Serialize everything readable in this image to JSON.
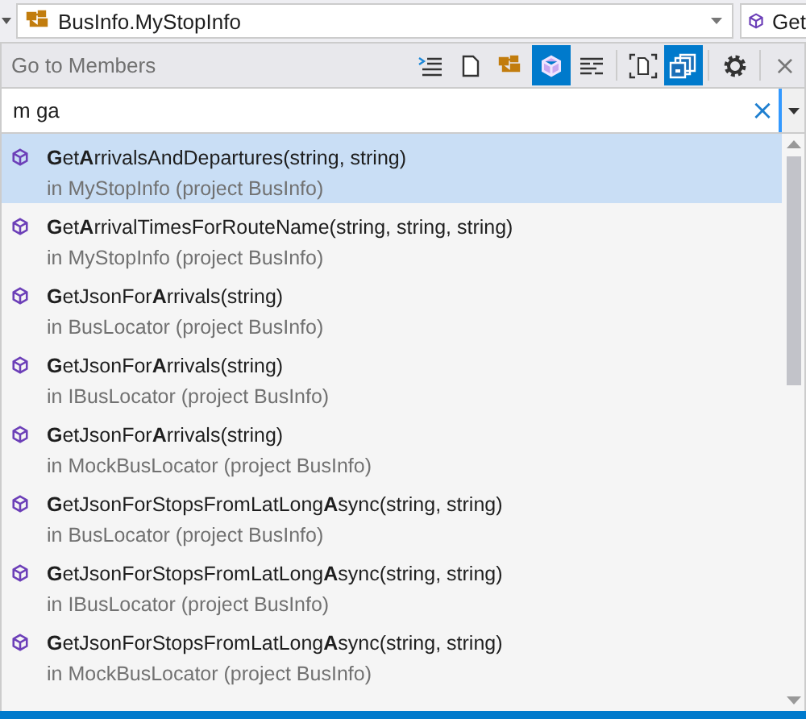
{
  "navigation_bar": {
    "type_dropdown": {
      "value": "BusInfo.MyStopInfo"
    },
    "member_dropdown": {
      "value": "Get"
    }
  },
  "panel": {
    "title": "Go to Members",
    "toolbar": [
      {
        "selected": false
      },
      {
        "selected": false
      },
      {
        "selected": false
      },
      {
        "selected": true
      },
      {
        "selected": false
      },
      {
        "selected": false
      },
      {
        "selected": true
      },
      {
        "selected": false
      }
    ],
    "close": "×"
  },
  "search": {
    "value": "m ga",
    "clear": "×"
  },
  "results": [
    {
      "name": "**G**et**A**rrivalsAndDepartures(string, string)",
      "location": "in MyStopInfo (project BusInfo)",
      "selected": true
    },
    {
      "name": "**G**et**A**rrivalTimesForRouteName(string, string, string)",
      "location": "in MyStopInfo (project BusInfo)",
      "selected": false
    },
    {
      "name": "**G**etJsonFor**A**rrivals(string)",
      "location": "in BusLocator (project BusInfo)",
      "selected": false
    },
    {
      "name": "**G**etJsonFor**A**rrivals(string)",
      "location": "in IBusLocator (project BusInfo)",
      "selected": false
    },
    {
      "name": "**G**etJsonFor**A**rrivals(string)",
      "location": "in MockBusLocator (project BusInfo)",
      "selected": false
    },
    {
      "name": "**G**etJsonForStopsFromLatLong**A**sync(string, string)",
      "location": "in BusLocator (project BusInfo)",
      "selected": false
    },
    {
      "name": "**G**etJsonForStopsFromLatLong**A**sync(string, string)",
      "location": "in IBusLocator (project BusInfo)",
      "selected": false
    },
    {
      "name": "**G**etJsonForStopsFromLatLong**A**sync(string, string)",
      "location": "in MockBusLocator (project BusInfo)",
      "selected": false
    }
  ]
}
